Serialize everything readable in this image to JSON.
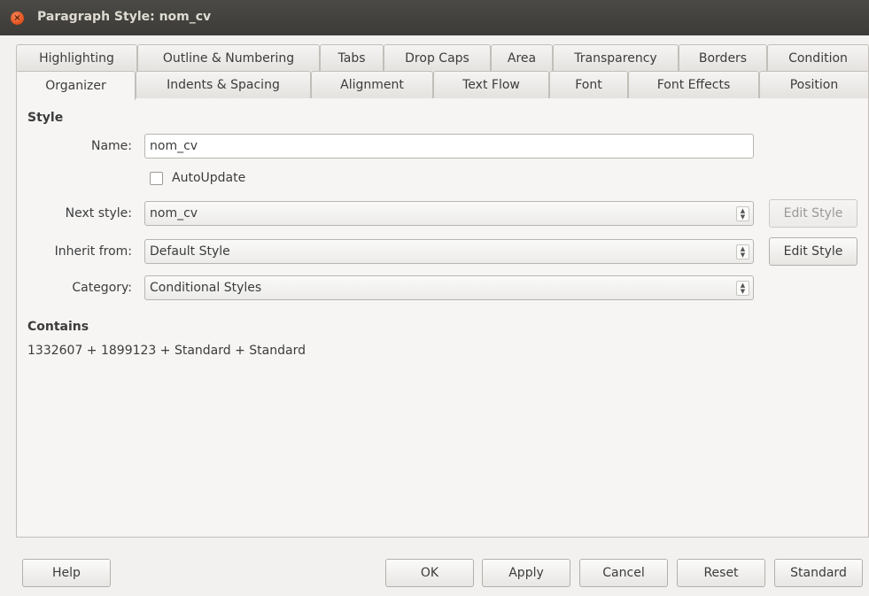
{
  "window": {
    "title": "Paragraph Style: nom_cv",
    "close_glyph": "×"
  },
  "tabs": {
    "top": [
      "Highlighting",
      "Outline & Numbering",
      "Tabs",
      "Drop Caps",
      "Area",
      "Transparency",
      "Borders",
      "Condition"
    ],
    "bottom": [
      "Organizer",
      "Indents & Spacing",
      "Alignment",
      "Text Flow",
      "Font",
      "Font Effects",
      "Position"
    ],
    "active": "Organizer"
  },
  "style_section": {
    "heading": "Style",
    "name_label": "Name:",
    "name_value": "nom_cv",
    "autoupdate_label": "AutoUpdate",
    "autoupdate_checked": false,
    "next_style_label": "Next style:",
    "next_style_value": "nom_cv",
    "inherit_label": "Inherit from:",
    "inherit_value": "Default Style",
    "category_label": "Category:",
    "category_value": "Conditional Styles",
    "edit_style_label": "Edit Style"
  },
  "contains_section": {
    "heading": "Contains",
    "text": "1332607 + 1899123 + Standard + Standard"
  },
  "buttons": {
    "help": "Help",
    "ok": "OK",
    "apply": "Apply",
    "cancel": "Cancel",
    "reset": "Reset",
    "standard": "Standard"
  },
  "icons": {
    "close": "close-icon",
    "combo_arrows": "spin-up-down-icon"
  },
  "colors": {
    "titlebar": "#3c3b37",
    "close_button": "#e5531f",
    "focus_border": "#e9753c"
  }
}
